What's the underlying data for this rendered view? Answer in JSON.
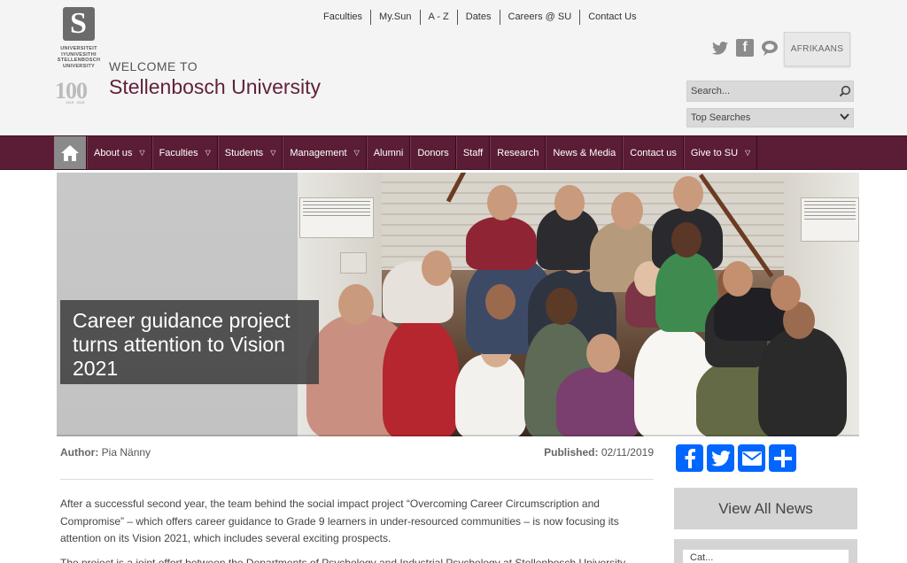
{
  "logo": {
    "mark": "S",
    "words": [
      "UNIVERSITEIT",
      "IYUNIVESITHI",
      "STELLENBOSCH",
      "UNIVERSITY"
    ],
    "centenary": "100",
    "centenary_sub": "1918 · 2018"
  },
  "header": {
    "welcome": "WELCOME TO",
    "university": "Stellenbosch University",
    "language_button": "AFRIKAANS"
  },
  "top_links": [
    "Faculties",
    "My.Sun",
    "A - Z",
    "Dates",
    "Careers @ SU",
    "Contact Us"
  ],
  "search": {
    "placeholder": "Search..."
  },
  "top_searches": {
    "selected": "Top Searches"
  },
  "nav": {
    "items": [
      {
        "label": "About us",
        "dropdown": true
      },
      {
        "label": "Faculties",
        "dropdown": true
      },
      {
        "label": "Students",
        "dropdown": true
      },
      {
        "label": "Management",
        "dropdown": true
      },
      {
        "label": "Alumni",
        "dropdown": false
      },
      {
        "label": "Donors",
        "dropdown": false
      },
      {
        "label": "Staff",
        "dropdown": false
      },
      {
        "label": "Research",
        "dropdown": false
      },
      {
        "label": "News & Media",
        "dropdown": false
      },
      {
        "label": "Contact us",
        "dropdown": false
      },
      {
        "label": "Give to SU",
        "dropdown": true
      }
    ]
  },
  "hero": {
    "caption": "Career guidance project turns attention to Vision 2021"
  },
  "article": {
    "author_label": "Author:",
    "author": "Pia Nänny",
    "published_label": "Published:",
    "published": "02/11/2019",
    "paragraph1": "After a successful second year, the team behind the social impact project “Overcoming Career Circumscription and Compromise” – which offers career guidance to Grade 9 learners in under-resourced communities – is now focusing its attention on its Vision 2021, which includes several exciting prospects.",
    "paragraph2": "The project is a joint effort between the Departments of Psychology and Industrial Psychology at Stellenbosch University"
  },
  "sidebar": {
    "view_all": "View All News",
    "box_text": "Cat..."
  },
  "colors": {
    "maroon": "#5a1d35",
    "brand_text": "#61223b",
    "share_blue": "#0166ff"
  }
}
